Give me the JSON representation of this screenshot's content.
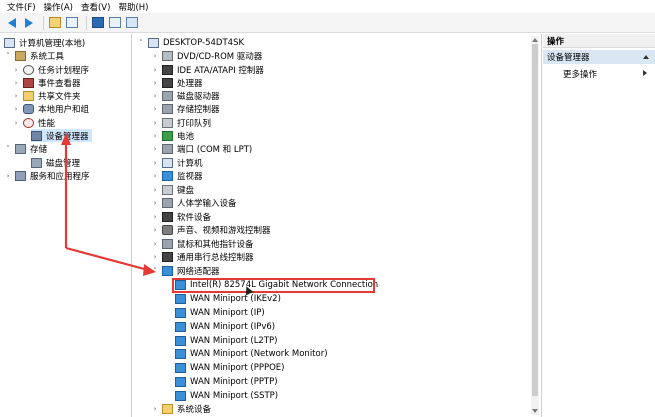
{
  "menubar": [
    "文件(F)",
    "操作(A)",
    "查看(V)",
    "帮助(H)"
  ],
  "colors": {
    "annotation": "#e53935",
    "selection": "#cfe5fb",
    "accent": "#1f7fd2"
  },
  "left_tree": {
    "root": "计算机管理(本地)",
    "system_tools": "系统工具",
    "items": [
      "任务计划程序",
      "事件查看器",
      "共享文件夹",
      "本地用户和组",
      "性能",
      "设备管理器"
    ],
    "storage": "存储",
    "disk_mgmt": "磁盘管理",
    "services": "服务和应用程序"
  },
  "device_tree": {
    "root": "DESKTOP-54DT4SK",
    "categories": [
      "DVD/CD-ROM 驱动器",
      "IDE ATA/ATAPI 控制器",
      "处理器",
      "磁盘驱动器",
      "存储控制器",
      "打印队列",
      "电池",
      "端口 (COM 和 LPT)",
      "计算机",
      "监视器",
      "键盘",
      "人体学输入设备",
      "软件设备",
      "声音、视频和游戏控制器",
      "鼠标和其他指针设备",
      "通用串行总线控制器",
      "网络适配器"
    ],
    "network_adapters": [
      "Intel(R) 82574L Gigabit Network Connection",
      "WAN Miniport (IKEv2)",
      "WAN Miniport (IP)",
      "WAN Miniport (IPv6)",
      "WAN Miniport (L2TP)",
      "WAN Miniport (Network Monitor)",
      "WAN Miniport (PPPOE)",
      "WAN Miniport (PPTP)",
      "WAN Miniport (SSTP)"
    ],
    "last_category": "系统设备"
  },
  "actions": {
    "header": "操作",
    "selected": "设备管理器",
    "more": "更多操作"
  }
}
